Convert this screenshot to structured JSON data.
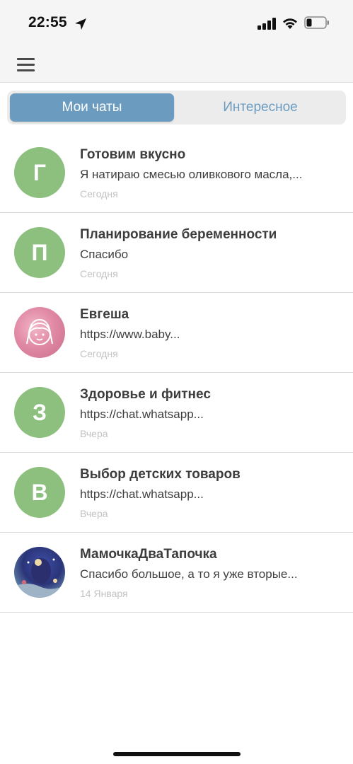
{
  "status_bar": {
    "time": "22:55",
    "icons": [
      "location-arrow-icon",
      "signal-icon",
      "wifi-icon",
      "battery-icon"
    ]
  },
  "nav": {
    "menu_icon": "hamburger-menu-icon"
  },
  "tabs": [
    {
      "label": "Мои чаты",
      "active": true
    },
    {
      "label": "Интересное",
      "active": false
    }
  ],
  "colors": {
    "accent": "#6b9cc0",
    "avatar_green": "#8dbf7e",
    "date_gray": "#c2c2c2"
  },
  "chats": [
    {
      "initial": "Г",
      "title": "Готовим вкусно",
      "preview": "Я натираю смесью оливкового масла,...",
      "date": "Сегодня",
      "avatar": "letter"
    },
    {
      "initial": "П",
      "title": "Планирование беременности",
      "preview": "Спасибо",
      "date": "Сегодня",
      "avatar": "letter"
    },
    {
      "initial": "",
      "title": "Евгеша",
      "preview": "https://www.baby...",
      "date": "Сегодня",
      "avatar": "photo"
    },
    {
      "initial": "З",
      "title": "Здоровье и фитнес",
      "preview": "https://chat.whatsapp...",
      "date": "Вчера",
      "avatar": "letter"
    },
    {
      "initial": "В",
      "title": "Выбор детских товаров",
      "preview": "https://chat.whatsapp...",
      "date": "Вчера",
      "avatar": "letter"
    },
    {
      "initial": "",
      "title": "МамочкаДваТапочка",
      "preview": "Спасибо большое, а то я уже вторые...",
      "date": "14 Января",
      "avatar": "photo"
    }
  ]
}
